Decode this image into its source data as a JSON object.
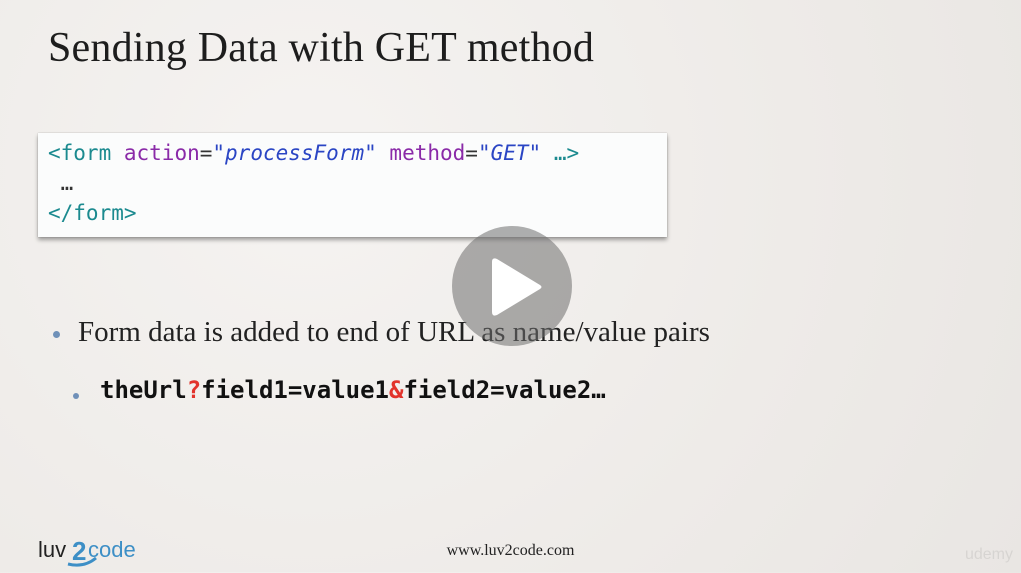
{
  "slide": {
    "title": "Sending Data with GET method"
  },
  "code": {
    "line1": {
      "open_tag": "<form",
      "attr1": "action",
      "eq1": "=",
      "val1": "\"processForm\"",
      "attr2": "method",
      "eq2": "=",
      "val2": "\"GET\"",
      "rest": "…>"
    },
    "line2": " …",
    "line3": "</form>"
  },
  "bullets": {
    "b1": "Form data is added to end of URL as name/value pairs",
    "b2": {
      "part1": "theUrl",
      "q": "?",
      "part2": "field1=value1",
      "amp": "&",
      "part3": "field2=value2…"
    }
  },
  "footer": {
    "url": "www.luv2code.com",
    "logo": "luv2code",
    "watermark": "udemy"
  },
  "player": {
    "play_icon": "play-icon"
  },
  "colors": {
    "tag": "#1b8a8f",
    "attr": "#8a2aa8",
    "string": "#2a45c4",
    "highlight": "#e2332b",
    "bullet": "#6f90b8",
    "logo_blue": "#3d8fc6"
  }
}
